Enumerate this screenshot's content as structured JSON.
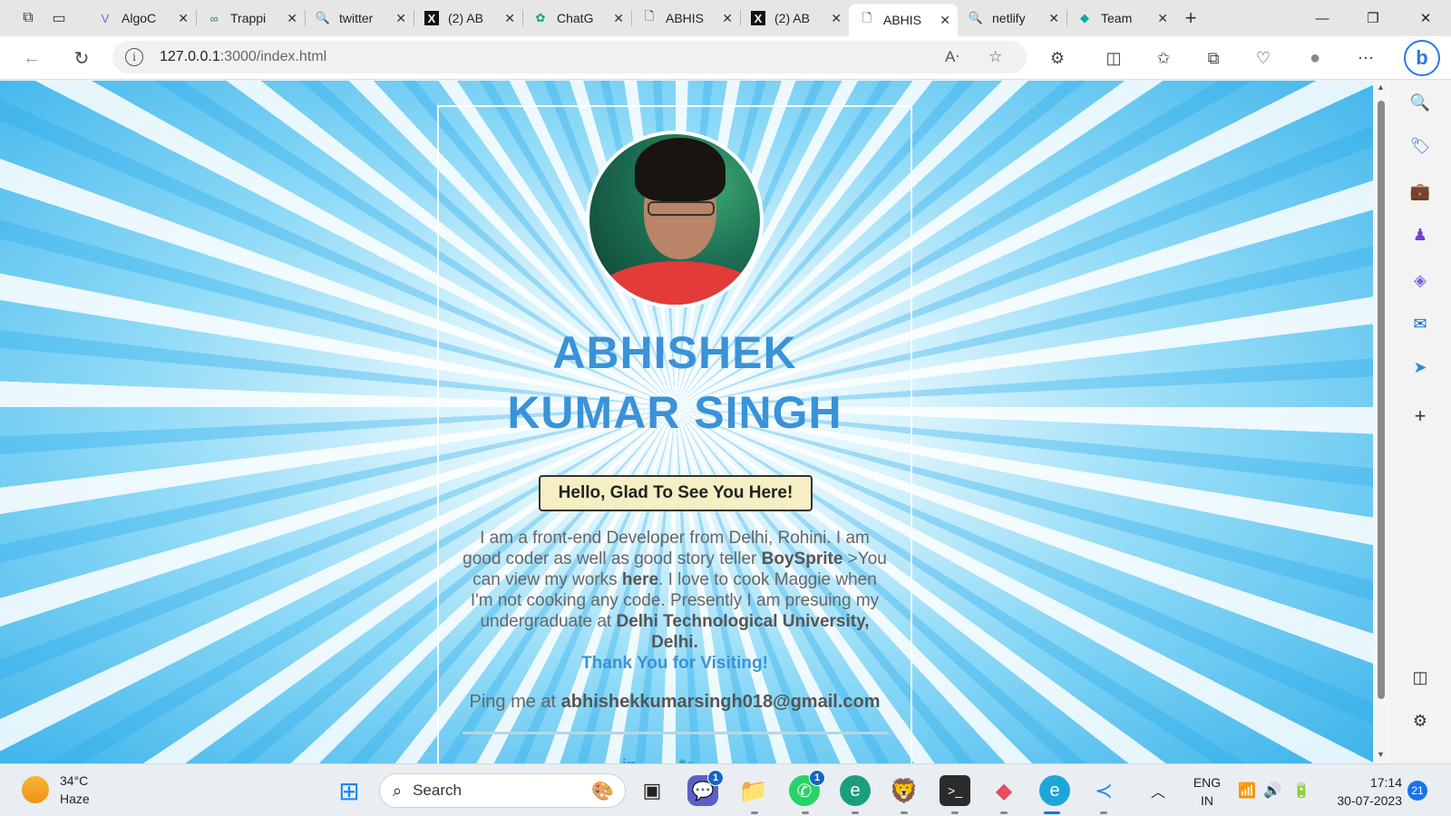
{
  "browser": {
    "tabs": [
      {
        "label": "AlgoC",
        "icon": "algo-icon"
      },
      {
        "label": "Trappi",
        "icon": "gfg-icon"
      },
      {
        "label": "twitter",
        "icon": "search-icon"
      },
      {
        "label": "(2) AB",
        "icon": "x-icon"
      },
      {
        "label": "ChatG",
        "icon": "chatgpt-icon"
      },
      {
        "label": "ABHIS",
        "icon": "page-icon"
      },
      {
        "label": "(2) AB",
        "icon": "x-icon"
      },
      {
        "label": "ABHIS",
        "icon": "page-icon",
        "active": true
      },
      {
        "label": "netlify",
        "icon": "search-icon"
      },
      {
        "label": "Team",
        "icon": "netlify-icon"
      }
    ],
    "url_host": "127.0.0.1",
    "url_rest": ":3000/index.html"
  },
  "page": {
    "name_line1": "ABHISHEK",
    "name_line2": "KUMAR SINGH",
    "hello_button": "Hello, Glad To See You Here!",
    "bio_p1": "I am a front-end Developer from Delhi, Rohini. I am good coder as well as good story teller ",
    "bio_b1": "BoySprite",
    "bio_p2": " >You can view my works ",
    "bio_b2": "here",
    "bio_p3": ". I love to cook Maggie when I'm not cooking any code. Presently I am presuing my undergraduate at ",
    "bio_b3": "Delhi Technological University, Delhi.",
    "thanks": "Thank You for Visiting!",
    "ping_label": "Ping me at ",
    "email": "abhishekkumarsingh018@gmail.com",
    "social": [
      "in",
      "🐦"
    ]
  },
  "taskbar": {
    "temperature": "34°C",
    "weather": "Haze",
    "search_placeholder": "Search",
    "teams_badge": "1",
    "whatsapp_badge": "1",
    "lang_line1": "ENG",
    "lang_line2": "IN",
    "time": "17:14",
    "date": "30-07-2023",
    "notifications": "21"
  },
  "colors": {
    "accent_blue": "#3a92d8",
    "hello_button_bg": "#f6efc3"
  }
}
